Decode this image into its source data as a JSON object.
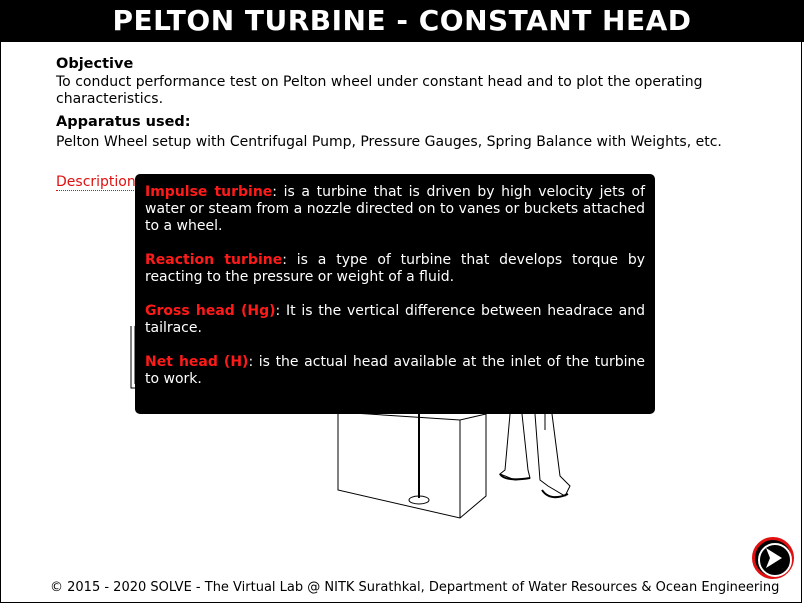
{
  "header": {
    "title": "PELTON TURBINE - CONSTANT HEAD"
  },
  "objective": {
    "heading": "Objective",
    "text": "To conduct performance test on Pelton wheel under constant head and to plot the operating characteristics."
  },
  "apparatus": {
    "heading": "Apparatus used:",
    "text": "Pelton Wheel setup with Centrifugal Pump, Pressure Gauges, Spring Balance with Weights, etc."
  },
  "description_link": "Description",
  "tooltip": {
    "items": [
      {
        "term": "Impulse turbine",
        "definition": ": is a turbine that is driven by high velocity jets of water or steam from a nozzle directed on to vanes or buckets attached to a wheel."
      },
      {
        "term": "Reaction turbine",
        "definition": ": is a type of turbine that develops torque by reacting to the pressure or weight of a fluid."
      },
      {
        "term": "Gross head (Hg)",
        "definition": ": It is the vertical difference between headrace and tailrace."
      },
      {
        "term": "Net head (H)",
        "definition": ": is the actual head available at the inlet of the turbine to work."
      }
    ]
  },
  "icons": {
    "next": "next-arrow-icon"
  },
  "colors": {
    "header_bg": "#000000",
    "accent_red": "#e01010",
    "tooltip_bg": "#000000"
  },
  "footer": "© 2015 - 2020 SOLVE - The Virtual Lab @ NITK Surathkal, Department of Water Resources & Ocean Engineering"
}
